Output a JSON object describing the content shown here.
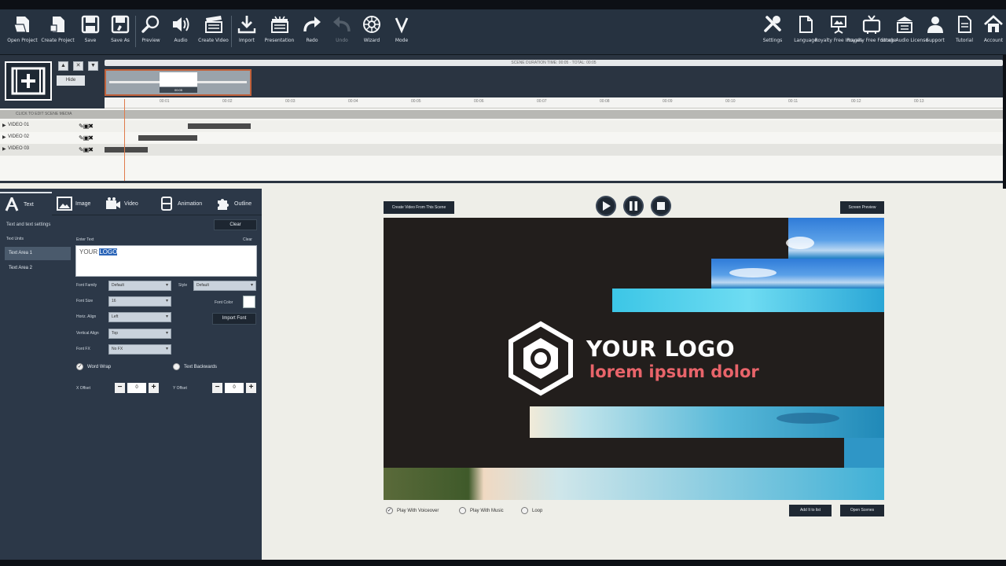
{
  "toolbar": {
    "left": [
      {
        "label": "Open Project",
        "icon": "open-project-icon"
      },
      {
        "label": "Create Project",
        "icon": "create-project-icon"
      },
      {
        "label": "Save",
        "icon": "save-icon"
      },
      {
        "label": "Save As",
        "icon": "save-as-icon"
      },
      {
        "label": "Preview",
        "icon": "preview-icon"
      },
      {
        "label": "Audio",
        "icon": "audio-icon"
      },
      {
        "label": "Create Video",
        "icon": "create-video-icon"
      },
      {
        "label": "Import",
        "icon": "import-icon"
      },
      {
        "label": "Presentation",
        "icon": "presentation-icon"
      },
      {
        "label": "Redo",
        "icon": "redo-icon"
      },
      {
        "label": "Undo",
        "icon": "undo-icon"
      },
      {
        "label": "Wizard",
        "icon": "wizard-icon"
      },
      {
        "label": "Mode",
        "icon": "mode-icon"
      }
    ],
    "right": [
      {
        "label": "Settings",
        "icon": "settings-icon"
      },
      {
        "label": "Language",
        "icon": "language-icon"
      },
      {
        "label": "Royalty Free Images",
        "icon": "images-icon"
      },
      {
        "label": "Royalty Free Footage",
        "icon": "footage-icon"
      },
      {
        "label": "Stock Audio License",
        "icon": "license-icon"
      },
      {
        "label": "Support",
        "icon": "support-icon"
      },
      {
        "label": "Tutorial",
        "icon": "tutorial-icon"
      },
      {
        "label": "Account",
        "icon": "account-icon"
      }
    ]
  },
  "timeline": {
    "scene_title": "SCENE DURATION TIME: 00:05 · TOTAL: 00:05",
    "hide_label": "Hide",
    "scene_thumb_label": "00:05",
    "ticks": [
      "00:01",
      "00:02",
      "00:03",
      "00:04",
      "00:05",
      "00:06",
      "00:07",
      "00:08",
      "00:09",
      "00:10",
      "00:11",
      "00:12",
      "00:13"
    ],
    "track_header": "CLICK TO EDIT SCENE MEDIA",
    "tracks": [
      {
        "name": "VIDEO 01",
        "clip_start": 0.093,
        "clip_end": 0.163
      },
      {
        "name": "VIDEO 02",
        "clip_start": 0.038,
        "clip_end": 0.103
      },
      {
        "name": "VIDEO 03",
        "clip_start": 0.0,
        "clip_end": 0.048
      }
    ]
  },
  "tabs": [
    {
      "label": "Text",
      "icon": "text-icon",
      "active": true
    },
    {
      "label": "Image",
      "icon": "image-icon",
      "active": false
    },
    {
      "label": "Video",
      "icon": "video-icon",
      "active": false
    },
    {
      "label": "Animation",
      "icon": "animation-icon",
      "active": false
    },
    {
      "label": "Outline",
      "icon": "outline-icon",
      "active": false
    }
  ],
  "text_panel": {
    "heading": "Text and text settings",
    "clear_label": "Clear",
    "list_title": "Text Units",
    "items": [
      "Text Area 1",
      "Text Area 2"
    ],
    "enter_text_label": "Enter Text",
    "clear_small": "Clear",
    "text_prefix": "YOUR ",
    "text_selected": "LOGO",
    "font_family_label": "Font Family",
    "font_family_value": "Default",
    "style_label": "Style",
    "style_value": "Default",
    "font_size_label": "Font Size",
    "font_size_value": "16",
    "font_color_label": "Font Color",
    "horiz_align_label": "Horiz. Align",
    "horiz_align_value": "Left",
    "vert_align_label": "Vertical Align",
    "vert_align_value": "Top",
    "font_fx_label": "Font FX",
    "font_fx_value": "No FX",
    "import_font_label": "Import Font",
    "word_wrap_label": "Word Wrap",
    "text_backwards_label": "Text Backwards",
    "x_offset_label": "X Offset",
    "x_offset_value": "0",
    "y_offset_label": "Y Offset",
    "y_offset_value": "0"
  },
  "preview": {
    "create_scene_label": "Create Video From This Scene",
    "fullscreen_label": "Screen Preview",
    "logo_line1": "YOUR LOGO",
    "logo_line2": "lorem ipsum dolor",
    "play_voiceover_label": "Play With Voiceover",
    "play_music_label": "Play With Music",
    "loop_label": "Loop",
    "add_to_list_label": "Add It to list",
    "open_scenes_label": "Open Scenes"
  },
  "colors": {
    "toolbar_bg": "#263240",
    "panel_bg": "#2c3848",
    "accent_text": "#e8646a",
    "canvas_bg": "#221e1c"
  }
}
